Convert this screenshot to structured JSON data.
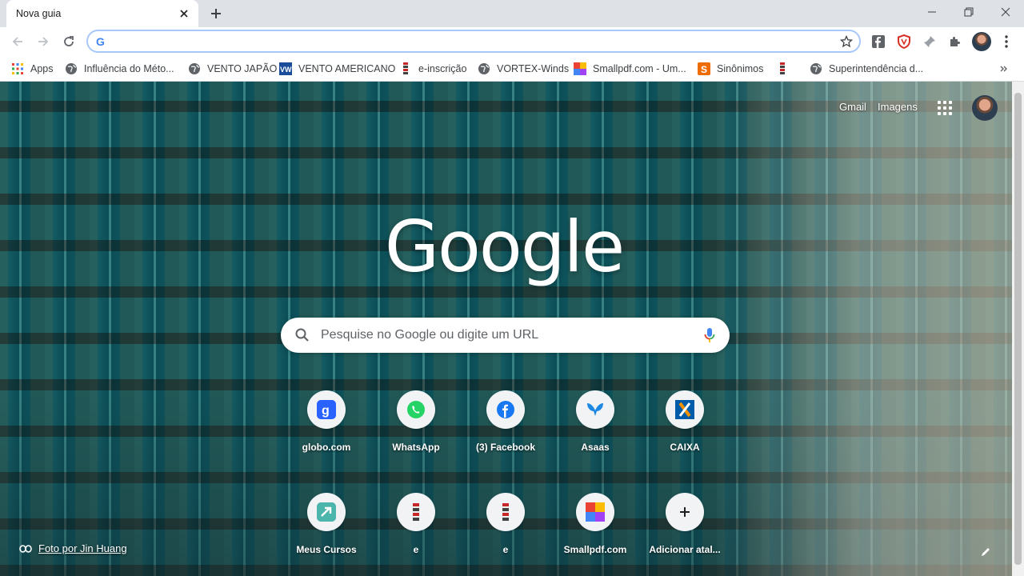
{
  "window": {
    "tab_title": "Nova guia",
    "controls": [
      "minimize-icon",
      "restore-icon",
      "close-icon"
    ]
  },
  "toolbar": {
    "omnibox_value": "",
    "omnibox_favicon": "G"
  },
  "bookmarks": [
    {
      "label": "Apps",
      "icon": "apps-grid-icon"
    },
    {
      "label": "Influência do Méto...",
      "icon": "globe-icon"
    },
    {
      "label": "VENTO JAPÃO",
      "icon": "globe-icon"
    },
    {
      "label": "VENTO AMERICANO",
      "icon": "vw-icon"
    },
    {
      "label": "e-inscrição",
      "icon": "stripe-icon"
    },
    {
      "label": "VORTEX-Winds",
      "icon": "globe-icon"
    },
    {
      "label": "Smallpdf.com - Um...",
      "icon": "smallpdf-icon"
    },
    {
      "label": "Sinônimos",
      "icon": "s-icon"
    },
    {
      "label": "",
      "icon": "stripe-icon"
    },
    {
      "label": "Superintendência d...",
      "icon": "globe-icon"
    }
  ],
  "ntp": {
    "gmail": "Gmail",
    "images": "Imagens",
    "logo": "Google",
    "search_placeholder": "Pesquise no Google ou digite um URL",
    "attribution": "Foto por Jin Huang",
    "shortcuts": [
      {
        "label": "globo.com",
        "icon": "globo-icon"
      },
      {
        "label": "WhatsApp",
        "icon": "whatsapp-icon"
      },
      {
        "label": "(3) Facebook",
        "icon": "facebook-icon"
      },
      {
        "label": "Asaas",
        "icon": "asaas-icon"
      },
      {
        "label": "CAIXA",
        "icon": "caixa-icon"
      },
      {
        "label": "Meus Cursos",
        "icon": "cursos-icon"
      },
      {
        "label": "e",
        "icon": "stripe-icon"
      },
      {
        "label": "e",
        "icon": "stripe-icon"
      },
      {
        "label": "Smallpdf.com",
        "icon": "smallpdf-icon"
      },
      {
        "label": "Adicionar atal...",
        "icon": "plus-icon"
      }
    ]
  },
  "colors": {
    "google_blue": "#4285f4",
    "google_red": "#ea4335",
    "google_yellow": "#fbbc05",
    "google_green": "#34a853",
    "whatsapp": "#25d366",
    "facebook": "#1877f2"
  }
}
